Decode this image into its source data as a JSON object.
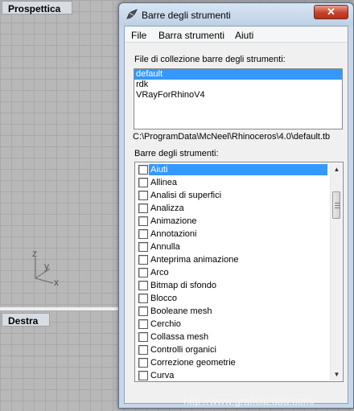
{
  "viewports": {
    "top_label": "Prospettica",
    "bottom_label": "Destra",
    "axis_labels": {
      "z": "z",
      "y": "y",
      "x": "x"
    }
  },
  "dialog": {
    "title": "Barre degli strumenti",
    "close_label": "✕",
    "menu": [
      "File",
      "Barra strumenti",
      "Aiuti"
    ],
    "files_label": "File di collezione barre degli strumenti:",
    "files": [
      {
        "name": "default",
        "selected": true
      },
      {
        "name": "rdk",
        "selected": false
      },
      {
        "name": "VRayForRhinoV4",
        "selected": false
      }
    ],
    "path": "C:\\ProgramData\\McNeel\\Rhinoceros\\4.0\\default.tb",
    "toolbars_label": "Barre degli strumenti:",
    "toolbars": [
      {
        "name": "Aiuti",
        "checked": false,
        "selected": true
      },
      {
        "name": "Allinea",
        "checked": false,
        "selected": false
      },
      {
        "name": "Analisi di superfici",
        "checked": false,
        "selected": false
      },
      {
        "name": "Analizza",
        "checked": false,
        "selected": false
      },
      {
        "name": "Animazione",
        "checked": false,
        "selected": false
      },
      {
        "name": "Annotazioni",
        "checked": false,
        "selected": false
      },
      {
        "name": "Annulla",
        "checked": false,
        "selected": false
      },
      {
        "name": "Anteprima animazione",
        "checked": false,
        "selected": false
      },
      {
        "name": "Arco",
        "checked": false,
        "selected": false
      },
      {
        "name": "Bitmap di sfondo",
        "checked": false,
        "selected": false
      },
      {
        "name": "Blocco",
        "checked": false,
        "selected": false
      },
      {
        "name": "Booleane mesh",
        "checked": false,
        "selected": false
      },
      {
        "name": "Cerchio",
        "checked": false,
        "selected": false
      },
      {
        "name": "Collassa mesh",
        "checked": false,
        "selected": false
      },
      {
        "name": "Controlli organici",
        "checked": false,
        "selected": false
      },
      {
        "name": "Correzione geometrie",
        "checked": false,
        "selected": false
      },
      {
        "name": "Curva",
        "checked": false,
        "selected": false
      }
    ]
  },
  "watermark": "http://www.grafica2d3d.com/",
  "colors": {
    "selection": "#3399ff",
    "titlebar": "#c7d7e8",
    "close": "#c7412a"
  }
}
